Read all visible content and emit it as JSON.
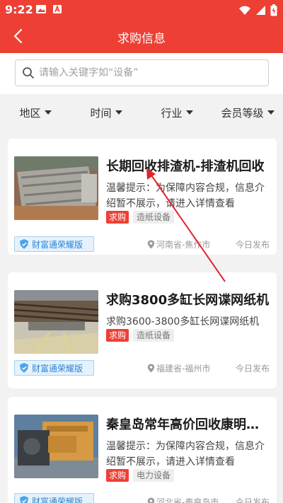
{
  "status_bar": {
    "time": "9:22"
  },
  "nav": {
    "title": "求购信息"
  },
  "search": {
    "placeholder": "请输入关键字如“设备”"
  },
  "filters": [
    {
      "label": "地区"
    },
    {
      "label": "时间"
    },
    {
      "label": "行业"
    },
    {
      "label": "会员等级"
    }
  ],
  "listings": [
    {
      "title": "长期回收排渣机-排渣机回收",
      "desc": "温馨提示：为保障内容合规，信息介绍暂不展示，请进入详情查看",
      "tag_type": "求购",
      "tag_category": "造纸设备",
      "badge": "财富通荣耀版",
      "location": "河南省-焦作市",
      "published": "今日发布"
    },
    {
      "title": "求购3800多缸长网谍网纸机",
      "desc": "求购3600-3800多缸长网谍网纸机",
      "tag_type": "求购",
      "tag_category": "造纸设备",
      "badge": "财富通荣耀版",
      "location": "福建省-福州市",
      "published": "今日发布"
    },
    {
      "title": "秦皇岛常年高价回收康明斯发电机",
      "desc": "温馨提示：为保障内容合规，信息介绍暂不展示，请进入详情查看",
      "tag_type": "求购",
      "tag_category": "电力设备",
      "badge": "财富通荣耀版",
      "location": "河北省-秦皇岛市",
      "published": "今日发布"
    }
  ],
  "colors": {
    "brand_red": "#ee3f34",
    "badge_blue": "#2a86d8"
  }
}
